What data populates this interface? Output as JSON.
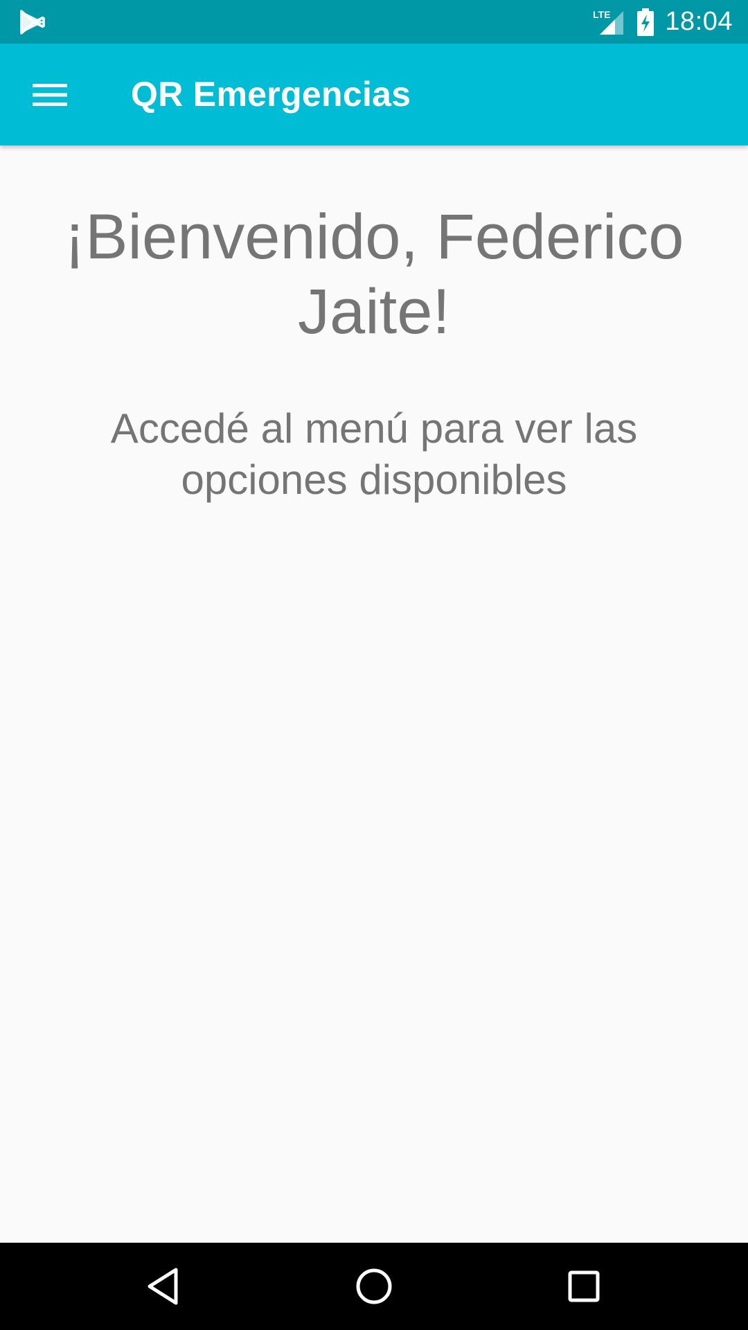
{
  "status_bar": {
    "time": "18:04",
    "network_label": "LTE",
    "icons": [
      "play-store-icon",
      "lte-signal-icon",
      "battery-charging-icon"
    ],
    "background_color": "#0097a7"
  },
  "app_bar": {
    "title": "QR Emergencias",
    "menu_icon": "hamburger-menu-icon",
    "background_color": "#00bcd4"
  },
  "main": {
    "welcome_title": "¡Bienvenido, Federico Jaite!",
    "welcome_subtitle": "Accedé al menú para ver las opciones disponibles",
    "text_color": "#757575"
  },
  "nav_bar": {
    "buttons": [
      "back-icon",
      "home-icon",
      "recent-apps-icon"
    ]
  }
}
